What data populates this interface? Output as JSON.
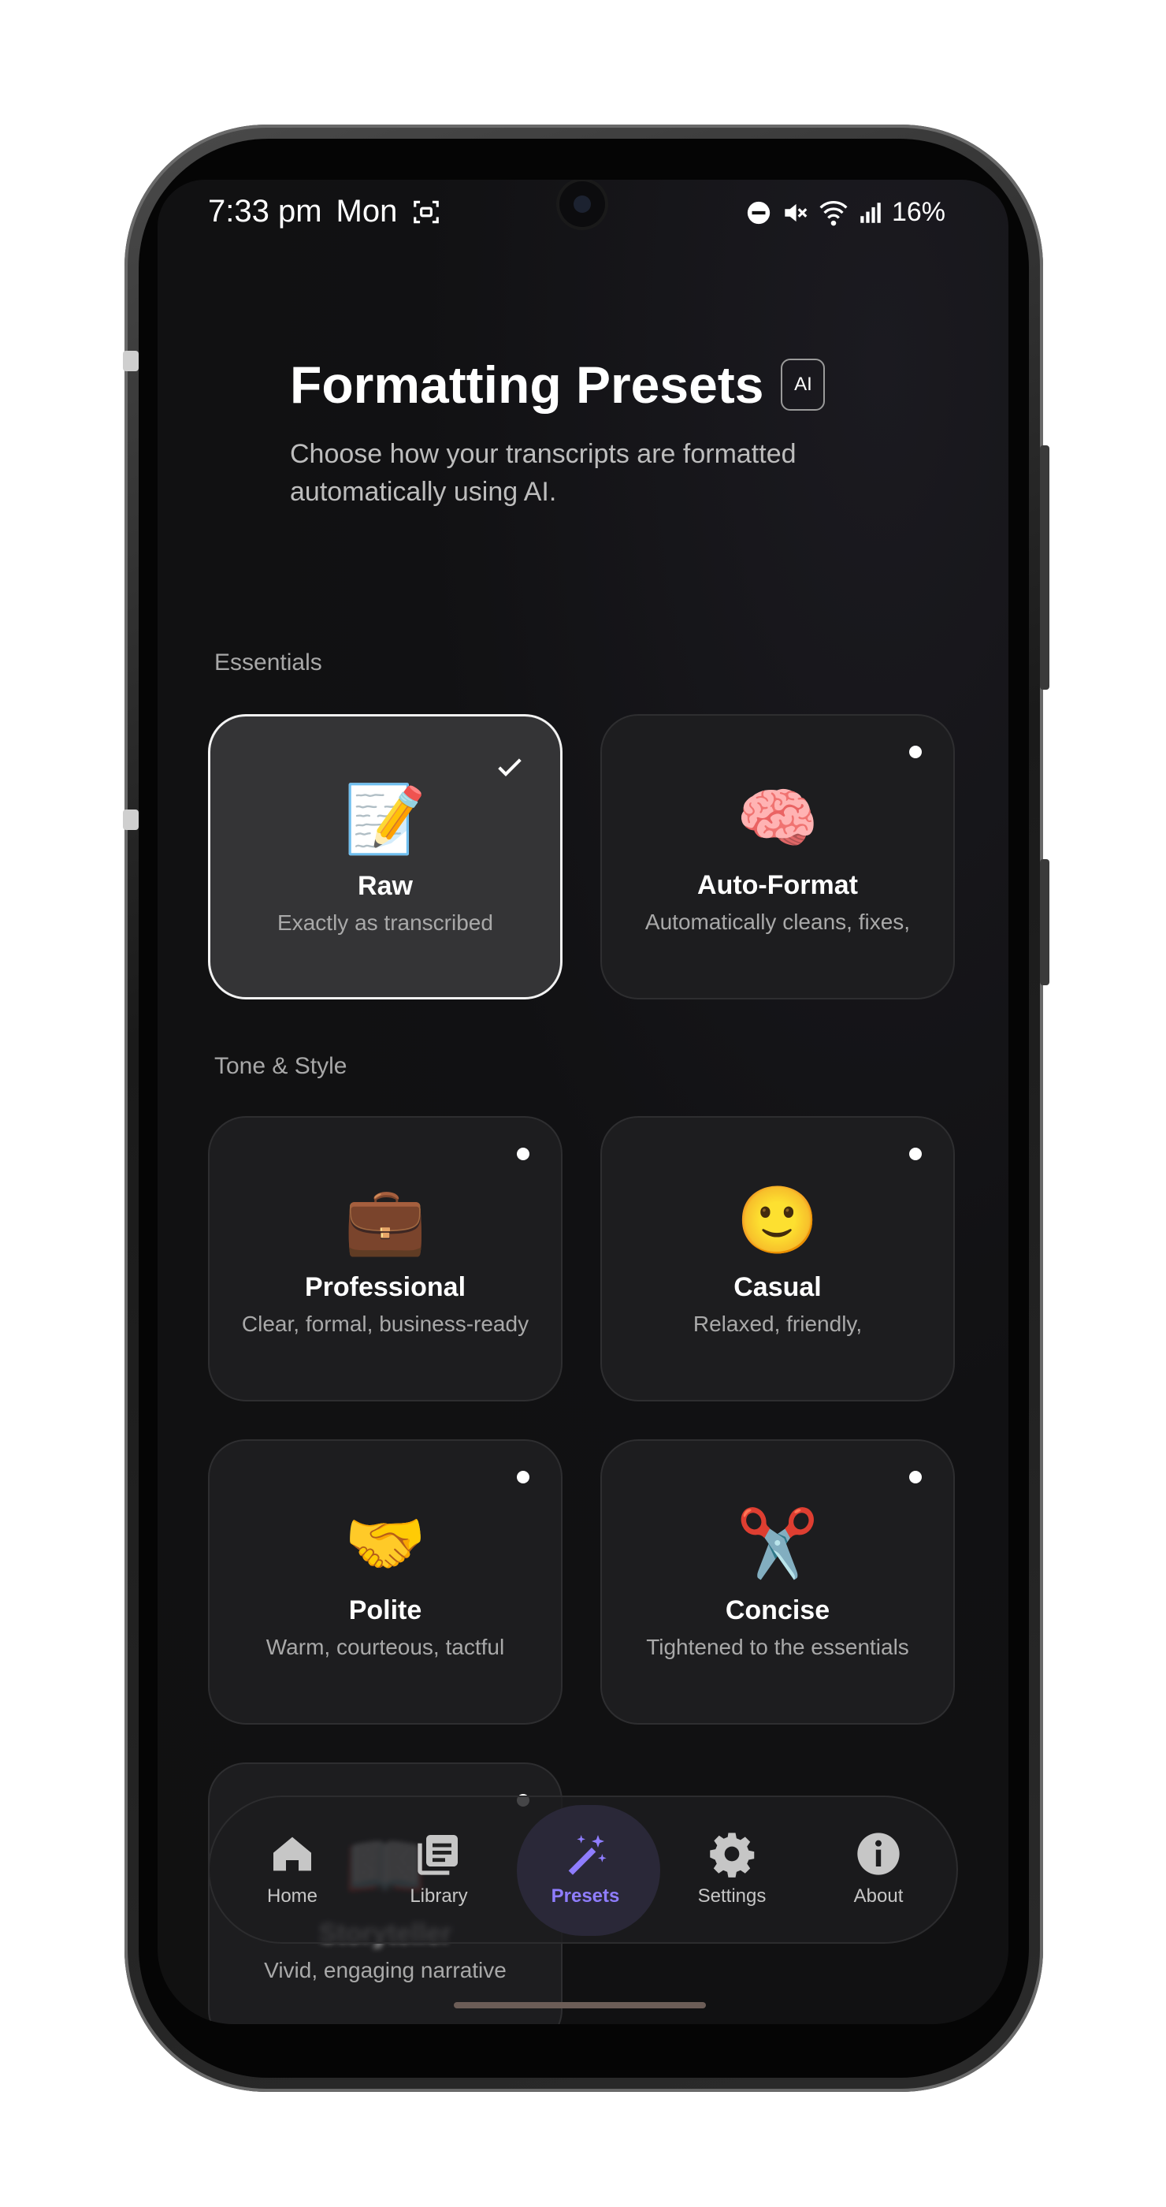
{
  "status_bar": {
    "time": "7:33 pm",
    "day": "Mon",
    "battery": "16%"
  },
  "header": {
    "title": "Formatting Presets",
    "badge": "AI",
    "subtitle": "Choose how your transcripts are formatted automatically using AI."
  },
  "sections": {
    "essentials": "Essentials",
    "tone_style": "Tone & Style"
  },
  "presets": [
    {
      "emoji": "📝",
      "name": "Raw",
      "desc": "Exactly as transcribed",
      "selected": true
    },
    {
      "emoji": "🧠",
      "name": "Auto-Format",
      "desc": "Automatically cleans, fixes,",
      "selected": false
    },
    {
      "emoji": "💼",
      "name": "Professional",
      "desc": "Clear, formal, business-ready",
      "selected": false
    },
    {
      "emoji": "🙂",
      "name": "Casual",
      "desc": "Relaxed, friendly,",
      "selected": false
    },
    {
      "emoji": "🤝",
      "name": "Polite",
      "desc": "Warm, courteous, tactful",
      "selected": false
    },
    {
      "emoji": "✂️",
      "name": "Concise",
      "desc": "Tightened to the essentials",
      "selected": false
    },
    {
      "emoji": "📖",
      "name": "Storyteller",
      "desc": "Vivid, engaging narrative",
      "selected": false
    }
  ],
  "nav": {
    "items": [
      {
        "label": "Home",
        "icon": "home-icon"
      },
      {
        "label": "Library",
        "icon": "library-icon"
      },
      {
        "label": "Presets",
        "icon": "magic-wand-icon"
      },
      {
        "label": "Settings",
        "icon": "gear-icon"
      },
      {
        "label": "About",
        "icon": "info-icon"
      }
    ],
    "active": "Presets",
    "active_color": "#8f7dff"
  }
}
